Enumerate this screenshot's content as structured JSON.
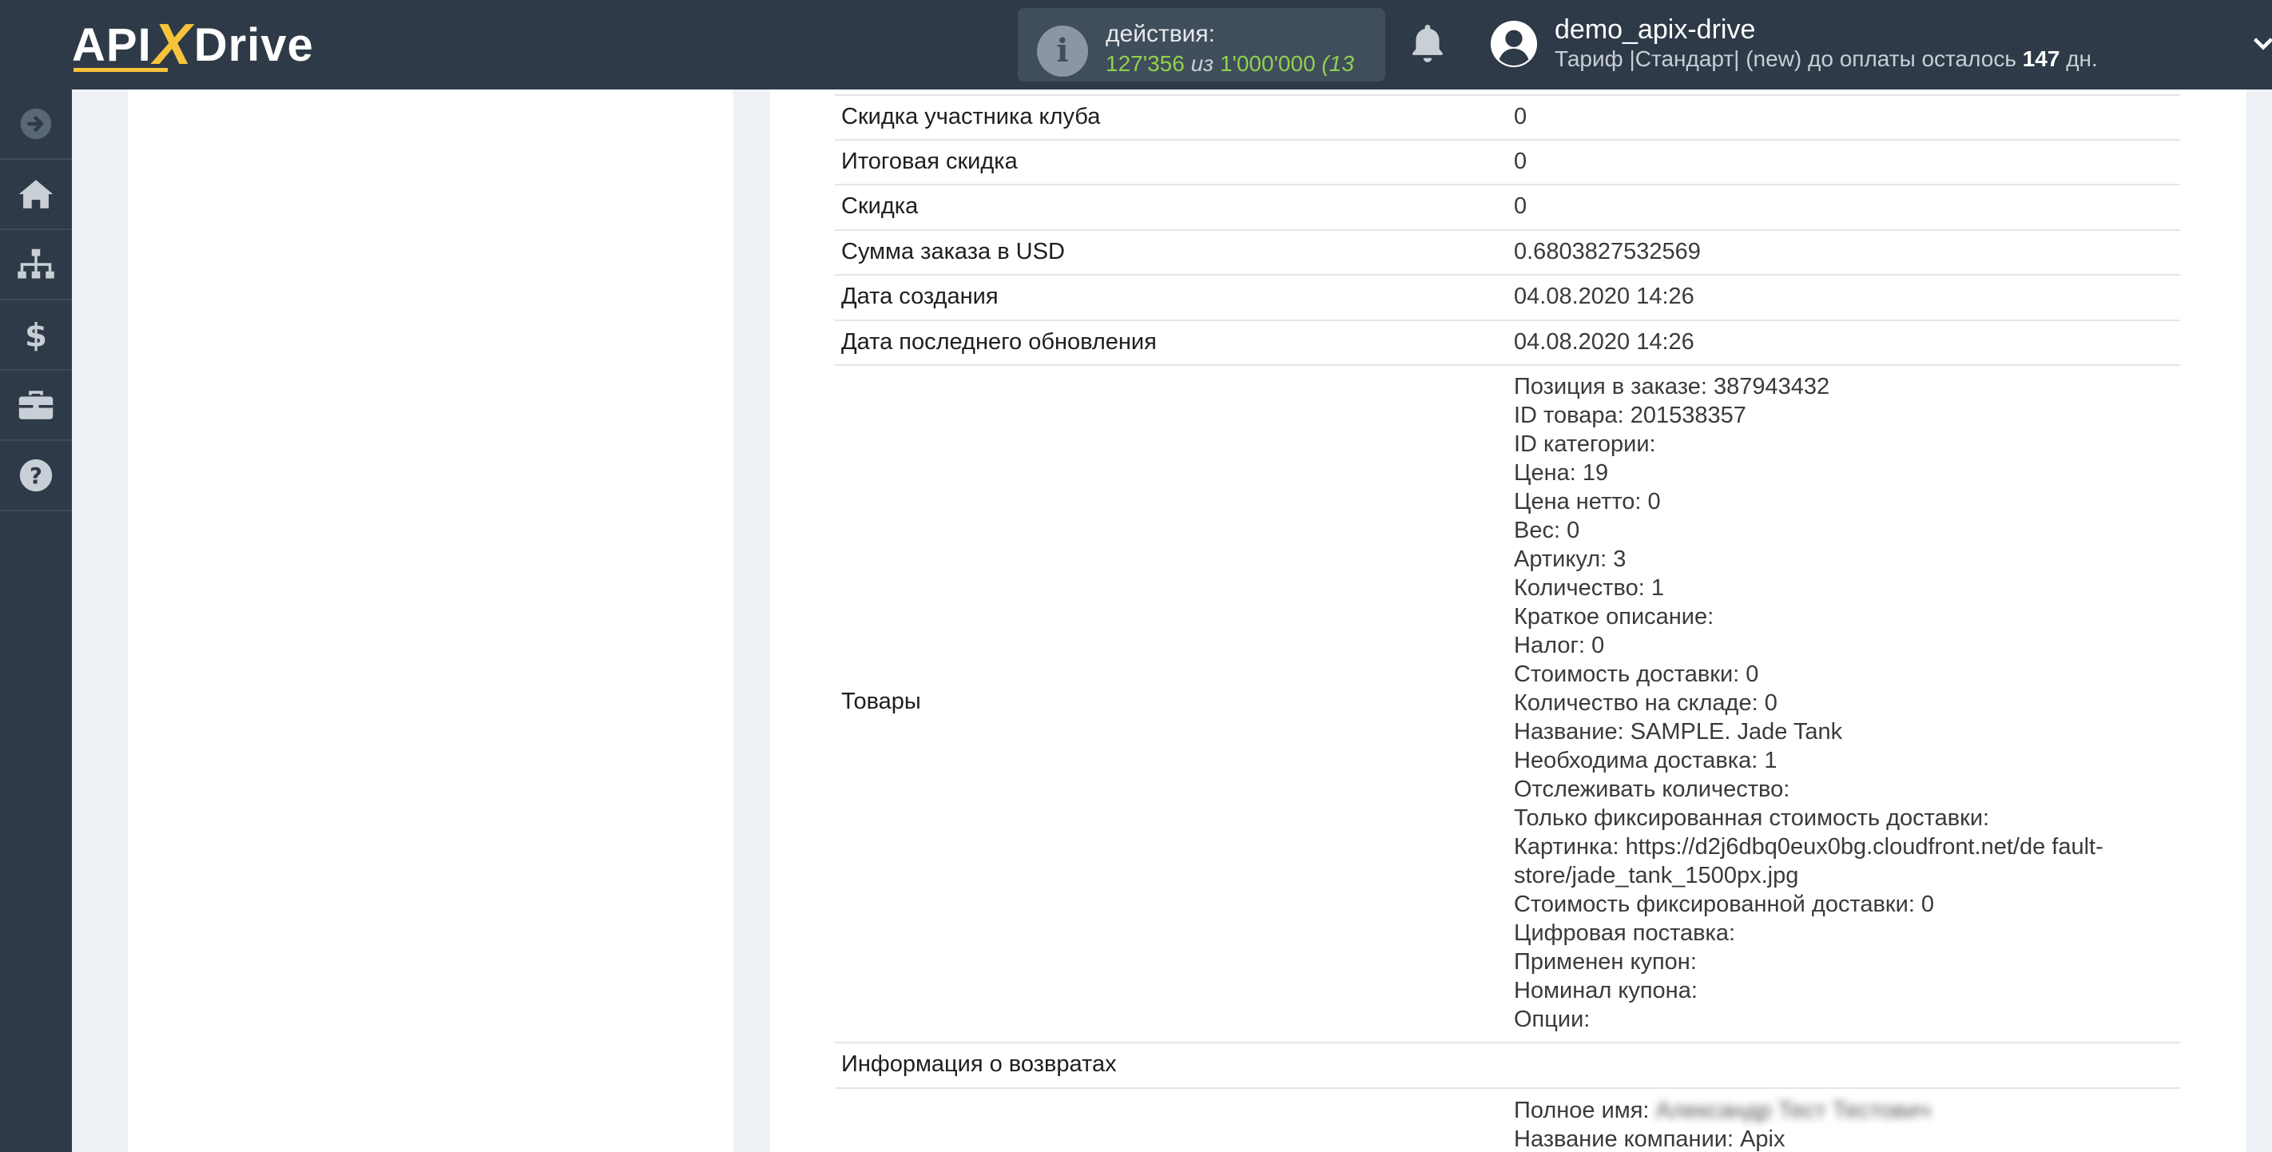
{
  "header": {
    "logo_api": "API",
    "logo_x": "X",
    "logo_drive": "Drive",
    "actions_label": "действия:",
    "actions_used": "127'356",
    "actions_of": "из",
    "actions_total": "1'000'000",
    "actions_extra": "(13",
    "user_name": "demo_apix-drive",
    "tariff_text": "Тариф |Стандарт| (new) до оплаты осталось",
    "tariff_days": "147",
    "tariff_days_suffix": "дн."
  },
  "sidebar": {
    "items": [
      "arrow-right-icon",
      "home-icon",
      "sitemap-icon",
      "dollar-icon",
      "briefcase-icon",
      "help-icon"
    ]
  },
  "rows": [
    {
      "key": "Скидка участника клуба",
      "value": "0"
    },
    {
      "key": "Итоговая скидка",
      "value": "0"
    },
    {
      "key": "Скидка",
      "value": "0"
    },
    {
      "key": "Сумма заказа в USD",
      "value": "0.6803827532569"
    },
    {
      "key": "Дата создания",
      "value": "04.08.2020 14:26"
    },
    {
      "key": "Дата последнего обновления",
      "value": "04.08.2020 14:26"
    }
  ],
  "products": {
    "key": "Товары",
    "lines": [
      "Позиция в заказе: 387943432",
      "ID товара: 201538357",
      "ID категории:",
      "Цена: 19",
      "Цена нетто: 0",
      "Вес: 0",
      "Артикул: 3",
      "Количество: 1",
      "Краткое описание:",
      "Налог: 0",
      "Стоимость доставки: 0",
      "Количество на складе: 0",
      "Название: SAMPLE. Jade Tank",
      "Необходима доставка: 1",
      "Отслеживать количество:",
      "Только фиксированная стоимость доставки:",
      "Картинка: https://d2j6dbq0eux0bg.cloudfront.net/de fault-",
      "store/jade_tank_1500px.jpg",
      "Стоимость фиксированной доставки: 0",
      "Цифровая поставка:",
      "Применен купон:",
      "Номинал купона:",
      "Опции:"
    ]
  },
  "returns": {
    "key": "Информация о возвратах",
    "value": ""
  },
  "tail": {
    "full_name_label": "Полное имя:",
    "full_name_value": "Александр Тест Тестович",
    "company_line": "Название компании: Apix"
  },
  "colors": {
    "topbar": "#2e3a47",
    "accent_green": "#8fd14f",
    "logo_yellow": "#f7c33a"
  }
}
